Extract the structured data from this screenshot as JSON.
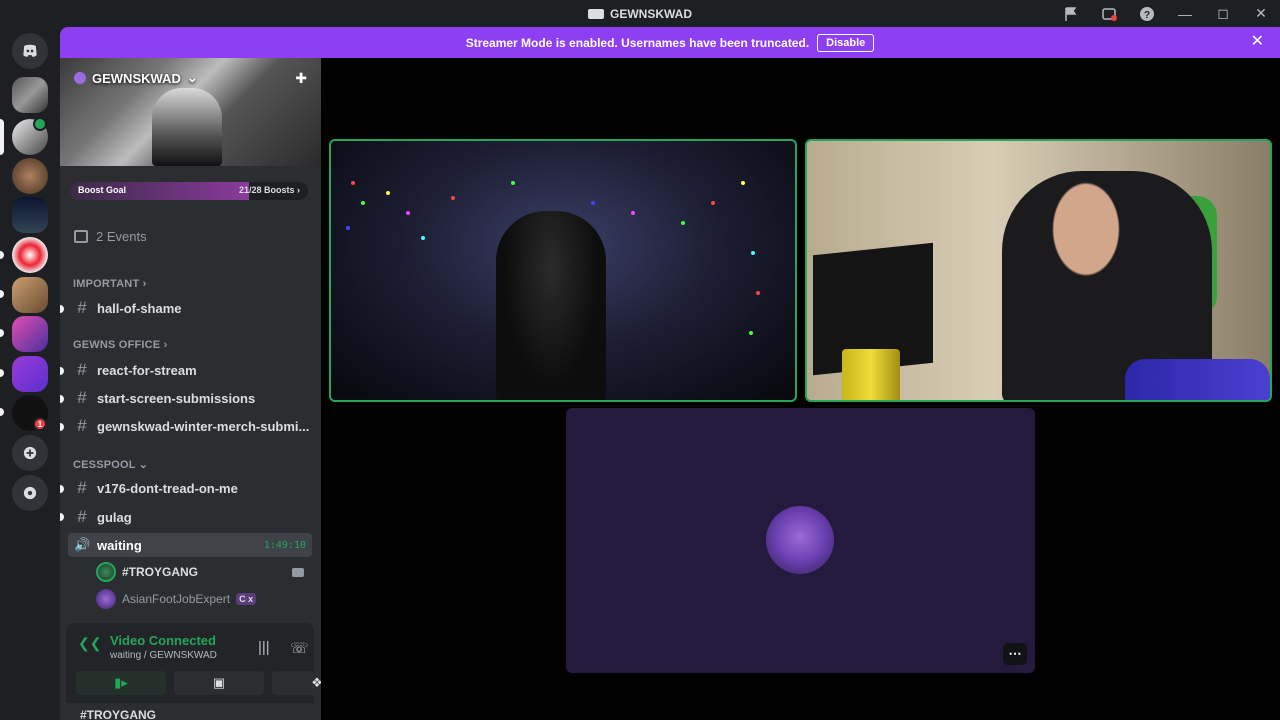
{
  "window": {
    "title": "GEWNSKWAD"
  },
  "banner": {
    "message": "Streamer Mode is enabled. Usernames have been truncated.",
    "disable_label": "Disable"
  },
  "server": {
    "name": "GEWNSKWAD",
    "boost_label": "Boost Goal",
    "boost_count": "21/28 Boosts",
    "boost_progress": 0.75,
    "events": "2 Events"
  },
  "categories": {
    "important": "IMPORTANT",
    "office": "GEWNS OFFICE",
    "cesspool": "CESSPOOL"
  },
  "channels": {
    "hall": "hall-of-shame",
    "react": "react-for-stream",
    "start": "start-screen-submissions",
    "merch": "gewnskwad-winter-merch-submi...",
    "v176": "v176-dont-tread-on-me",
    "gulag": "gulag",
    "waiting": "waiting",
    "waiting_timer": "1:49:10"
  },
  "voice_users": [
    {
      "name": "#TROYGANG"
    },
    {
      "name": "AsianFootJobExpert",
      "tag": "C x"
    }
  ],
  "voice_panel": {
    "status": "Video Connected",
    "location": "waiting / GEWNSKWAD"
  },
  "bottom_user": "#TROYGANG",
  "colors": {
    "accent": "#8f3ff2",
    "speaking": "#23a55a",
    "sidebar": "#2b2d31"
  }
}
